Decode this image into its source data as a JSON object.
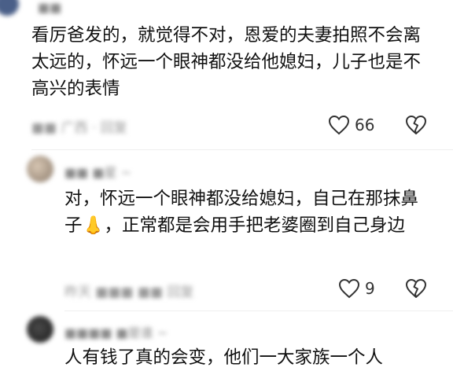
{
  "comments": [
    {
      "username": "■■",
      "text": "看厉爸发的，就觉得不对，恩爱的夫妻拍照不会离太远的，怀远一个眼神都没给他媳妇，儿子也是不高兴的表情",
      "meta": "■■ 广西 · 回复",
      "likes": "66"
    },
    {
      "username": "■■ ■星 ~",
      "text": "对，怀远一个眼神都没给媳妇，自己在那抹鼻子👃，正常都是会用手把老婆圈到自己身边",
      "meta": "昨天 ■■■ ■■ 回复",
      "likes": "9"
    },
    {
      "username": "■■■■ ■是谁 ~",
      "text": "人有钱了真的会变，他们一大家族一个人",
      "meta": ""
    }
  ],
  "icons": {
    "like": "heart-icon",
    "dislike": "broken-heart-icon"
  },
  "colors": {
    "text": "#111111",
    "meta": "#9a9a9a",
    "avatar_top": "#5a6c8c"
  }
}
